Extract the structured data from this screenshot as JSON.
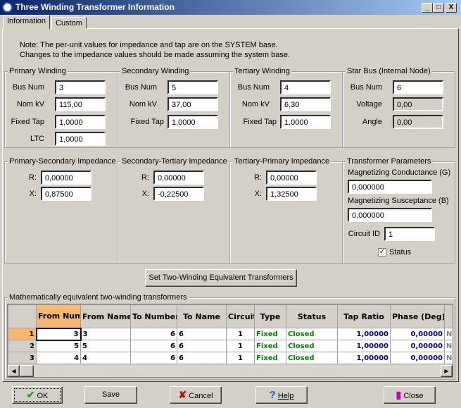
{
  "window": {
    "title": "Three Winding Transformer Information",
    "controls": [
      "_",
      "□",
      "X"
    ]
  },
  "tabs": [
    "Information",
    "Custom"
  ],
  "note": [
    "Note: The per-unit values for impedance and tap are on the SYSTEM base.",
    "Changes to the impedance values should be made assuming the system base."
  ],
  "primary": {
    "title": "Primary Winding",
    "bus_num_label": "Bus Num",
    "bus_num": "3",
    "nomkv_label": "Nom kV",
    "nomkv": "115,00",
    "tap_label": "Fixed Tap",
    "tap": "1,0000",
    "ltc_label": "LTC",
    "ltc": "1,0000"
  },
  "secondary": {
    "title": "Secondary Winding",
    "bus_num_label": "Bus Num",
    "bus_num": "5",
    "nomkv_label": "Nom kV",
    "nomkv": "37,00",
    "tap_label": "Fixed Tap",
    "tap": "1,0000"
  },
  "tertiary": {
    "title": "Tertiary Winding",
    "bus_num_label": "Bus Num",
    "bus_num": "4",
    "nomkv_label": "Nom kV",
    "nomkv": "6,30",
    "tap_label": "Fixed Tap",
    "tap": "1,0000"
  },
  "star": {
    "title": "Star Bus (Internal Node)",
    "bus_num_label": "Bus Num",
    "bus_num": "6",
    "voltage_label": "Voltage",
    "voltage": "0,00",
    "angle_label": "Angle",
    "angle": "0,00"
  },
  "ps": {
    "title": "Primary-Secondary Impedance",
    "r_label": "R:",
    "r": "0,00000",
    "x_label": "X:",
    "x": "0,87500"
  },
  "st": {
    "title": "Secondary-Tertiary Impedance",
    "r_label": "R:",
    "r": "0,00000",
    "x_label": "X:",
    "x": "-0,22500"
  },
  "tp": {
    "title": "Tertiary-Primary Impedance",
    "r_label": "R:",
    "r": "0,00000",
    "x_label": "X:",
    "x": "1,32500"
  },
  "params": {
    "title": "Transformer Parameters",
    "g_label": "Magnetizing Conductance (G)",
    "g": "0,000000",
    "b_label": "Magnetizing Susceptance (B)",
    "b": "0,000000",
    "cid_label": "Circuit ID",
    "cid": "1",
    "status_label": "Status",
    "status_checked": true
  },
  "set_button": "Set Two-Winding Equivalent Transformers",
  "grid": {
    "title": "Mathematically equivalent two-winding transformers",
    "columns": [
      "",
      "From Number",
      "From Name",
      "To Number",
      "To Name",
      "Circuit",
      "Type",
      "Status",
      "Tap Ratio",
      "Phase (Deg)",
      "No"
    ],
    "rows": [
      [
        "1",
        "3",
        "3",
        "6",
        "6",
        "1",
        "Fixed",
        "Closed",
        "1,00000",
        "0,00000",
        "No"
      ],
      [
        "2",
        "5",
        "5",
        "6",
        "6",
        "1",
        "Fixed",
        "Closed",
        "1,00000",
        "0,00000",
        "No"
      ],
      [
        "3",
        "4",
        "4",
        "6",
        "6",
        "1",
        "Fixed",
        "Closed",
        "1,00000",
        "0,00000",
        "No"
      ]
    ]
  },
  "buttons": {
    "ok": "OK",
    "save": "Save",
    "cancel": "Cancel",
    "help": "Help",
    "close": "Close"
  }
}
